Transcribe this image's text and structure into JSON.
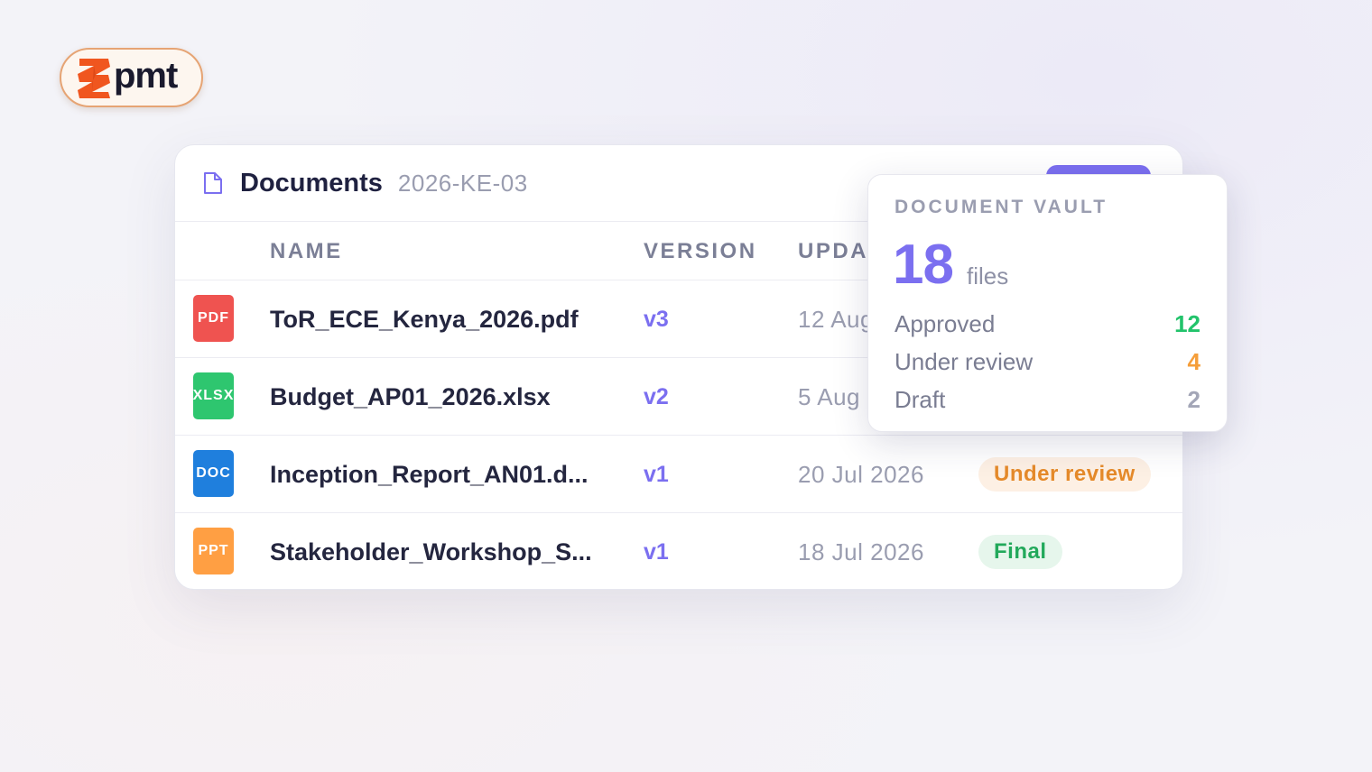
{
  "brand": {
    "wordmark": "pmt",
    "colors": {
      "primary": "#f0561f",
      "accent": "#7b6ff0"
    }
  },
  "documents": {
    "title": "Documents",
    "code": "2026-KE-03",
    "columns": {
      "name": "NAME",
      "version": "VERSION",
      "updated": "UPDA"
    },
    "rows": [
      {
        "type": "PDF",
        "type_color": "#ef5350",
        "name": "ToR_ECE_Kenya_2026.pdf",
        "version": "v3",
        "updated": "12 Aug"
      },
      {
        "type": "XLSX",
        "type_color": "#2ec66f",
        "name": "Budget_AP01_2026.xlsx",
        "version": "v2",
        "updated": "5 Aug"
      },
      {
        "type": "DOC",
        "type_color": "#1f7fdd",
        "name": "Inception_Report_AN01.d...",
        "version": "v1",
        "updated": "20 Jul 2026",
        "status": "Under review",
        "status_fg": "#e58a2a",
        "status_bg": "#fdf0e4"
      },
      {
        "type": "PPT",
        "type_color": "#ff9f43",
        "name": "Stakeholder_Workshop_S...",
        "version": "v1",
        "updated": "18 Jul 2026",
        "status": "Final",
        "status_fg": "#22a95b",
        "status_bg": "#e6f6ec"
      }
    ]
  },
  "vault": {
    "title": "DOCUMENT VAULT",
    "count": "18",
    "unit": "files",
    "breakdown": [
      {
        "label": "Approved",
        "value": "12",
        "color": "#22c36b"
      },
      {
        "label": "Under review",
        "value": "4",
        "color": "#f59e3a"
      },
      {
        "label": "Draft",
        "value": "2",
        "color": "#a3a6b7"
      }
    ]
  }
}
